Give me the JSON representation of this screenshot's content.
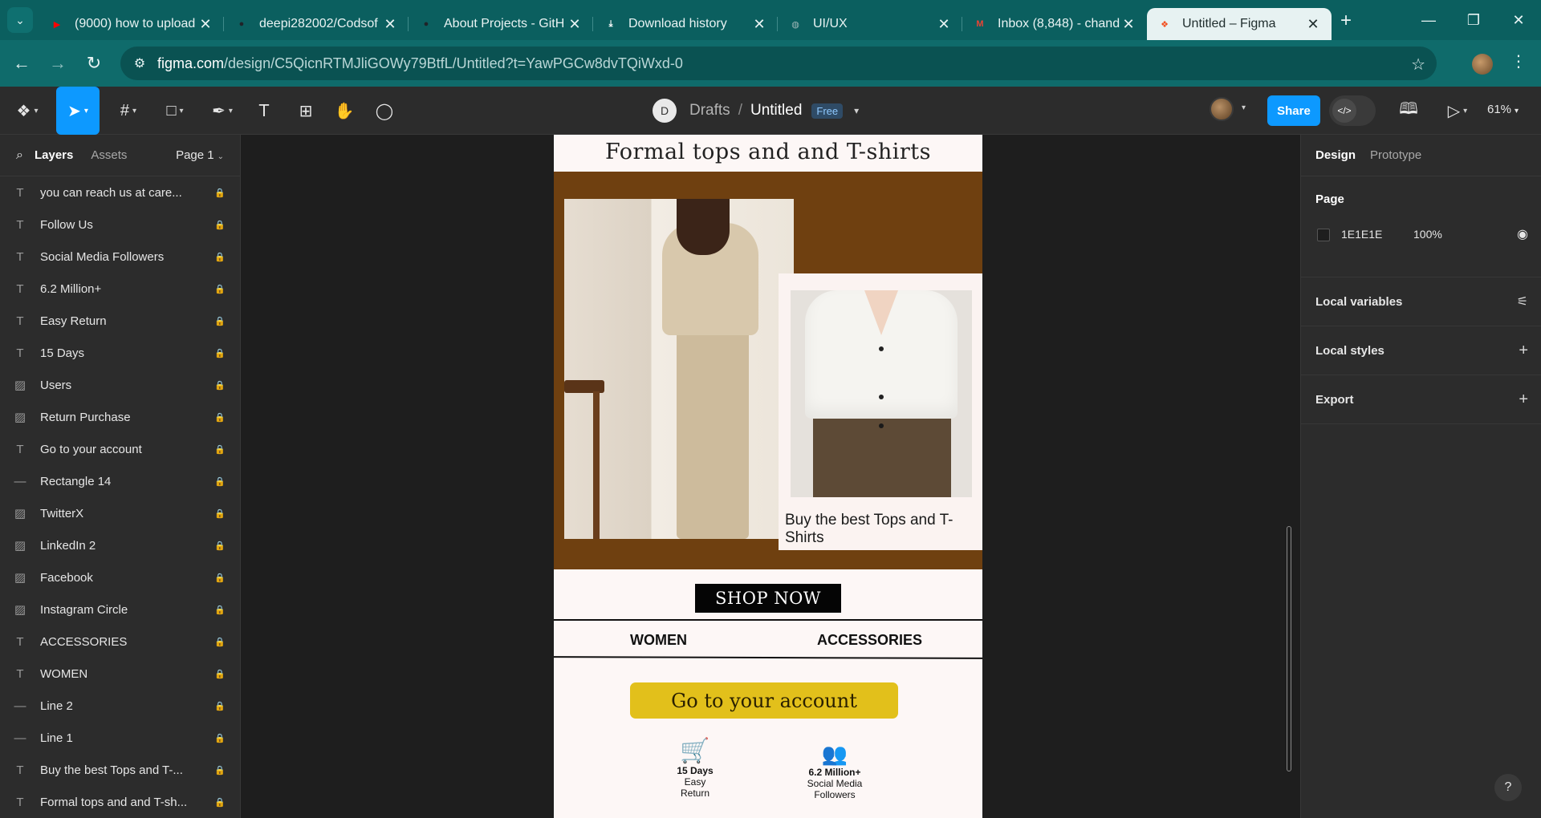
{
  "browser": {
    "tabs": [
      {
        "title": "(9000) how to upload",
        "favicon": "youtube-icon",
        "color": "#ff0000"
      },
      {
        "title": "deepi282002/Codsof",
        "favicon": "github-icon",
        "color": "#1f2328"
      },
      {
        "title": "About Projects - GitH",
        "favicon": "github-icon",
        "color": "#1f2328"
      },
      {
        "title": "Download history",
        "favicon": "download-icon",
        "color": "#ffffff"
      },
      {
        "title": "UI/UX",
        "favicon": "globe-icon",
        "color": "#9fb8b8"
      },
      {
        "title": "Inbox (8,848) - chand",
        "favicon": "gmail-icon",
        "color": "#ea4335"
      },
      {
        "title": "Untitled – Figma",
        "favicon": "figma-icon",
        "color": "#f24e1e"
      }
    ],
    "url_host": "figma.com",
    "url_path": "/design/C5QicnRTMJliGOWy79BtfL/Untitled?t=YawPGCw8dvTQiWxd-0"
  },
  "figma": {
    "avatar_letter": "D",
    "drafts": "Drafts",
    "file_name": "Untitled",
    "plan_badge": "Free",
    "share": "Share",
    "zoom": "61%"
  },
  "left_panel": {
    "tab_layers": "Layers",
    "tab_assets": "Assets",
    "page_select": "Page 1",
    "layers": [
      {
        "name": "you can reach us at care...",
        "type": "text"
      },
      {
        "name": "Follow Us",
        "type": "text"
      },
      {
        "name": "Social Media Followers",
        "type": "text"
      },
      {
        "name": "6.2 Million+",
        "type": "text"
      },
      {
        "name": "Easy Return",
        "type": "text"
      },
      {
        "name": "15 Days",
        "type": "text"
      },
      {
        "name": "Users",
        "type": "image"
      },
      {
        "name": "Return Purchase",
        "type": "image"
      },
      {
        "name": "Go to your account",
        "type": "text"
      },
      {
        "name": "Rectangle 14",
        "type": "line"
      },
      {
        "name": "TwitterX",
        "type": "image"
      },
      {
        "name": "LinkedIn 2",
        "type": "image"
      },
      {
        "name": "Facebook",
        "type": "image"
      },
      {
        "name": "Instagram Circle",
        "type": "image"
      },
      {
        "name": "ACCESSORIES",
        "type": "text"
      },
      {
        "name": "WOMEN",
        "type": "text"
      },
      {
        "name": "Line 2",
        "type": "line"
      },
      {
        "name": "Line 1",
        "type": "line"
      },
      {
        "name": "Buy the best Tops and T-...",
        "type": "text"
      },
      {
        "name": "Formal tops and and T-sh...",
        "type": "text"
      }
    ]
  },
  "canvas": {
    "heading": "Formal tops and  and T-shirts",
    "caption": "Buy the best Tops and T-Shirts",
    "shop_now": "SHOP NOW",
    "nav_women": "WOMEN",
    "nav_accessories": "ACCESSORIES",
    "account_button": "Go to your account",
    "stat1_big": "15 Days",
    "stat1_small_1": "Easy",
    "stat1_small_2": "Return",
    "stat2_big": "6.2 Million+",
    "stat2_small_1": "Social Media",
    "stat2_small_2": "Followers",
    "brand_brown": "#6f4010",
    "accent_yellow": "#e2c01b"
  },
  "right_panel": {
    "tab_design": "Design",
    "tab_prototype": "Prototype",
    "page_label": "Page",
    "page_color": "1E1E1E",
    "page_opacity": "100%",
    "local_variables": "Local variables",
    "local_styles": "Local styles",
    "export": "Export"
  }
}
